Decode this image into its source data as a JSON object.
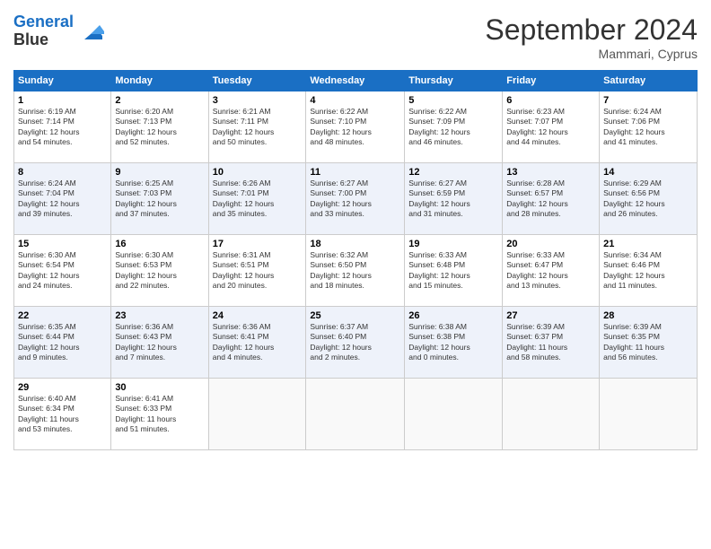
{
  "header": {
    "logo_line1": "General",
    "logo_line2": "Blue",
    "month_title": "September 2024",
    "location": "Mammari, Cyprus"
  },
  "weekdays": [
    "Sunday",
    "Monday",
    "Tuesday",
    "Wednesday",
    "Thursday",
    "Friday",
    "Saturday"
  ],
  "weeks": [
    [
      {
        "day": "1",
        "info": "Sunrise: 6:19 AM\nSunset: 7:14 PM\nDaylight: 12 hours\nand 54 minutes."
      },
      {
        "day": "2",
        "info": "Sunrise: 6:20 AM\nSunset: 7:13 PM\nDaylight: 12 hours\nand 52 minutes."
      },
      {
        "day": "3",
        "info": "Sunrise: 6:21 AM\nSunset: 7:11 PM\nDaylight: 12 hours\nand 50 minutes."
      },
      {
        "day": "4",
        "info": "Sunrise: 6:22 AM\nSunset: 7:10 PM\nDaylight: 12 hours\nand 48 minutes."
      },
      {
        "day": "5",
        "info": "Sunrise: 6:22 AM\nSunset: 7:09 PM\nDaylight: 12 hours\nand 46 minutes."
      },
      {
        "day": "6",
        "info": "Sunrise: 6:23 AM\nSunset: 7:07 PM\nDaylight: 12 hours\nand 44 minutes."
      },
      {
        "day": "7",
        "info": "Sunrise: 6:24 AM\nSunset: 7:06 PM\nDaylight: 12 hours\nand 41 minutes."
      }
    ],
    [
      {
        "day": "8",
        "info": "Sunrise: 6:24 AM\nSunset: 7:04 PM\nDaylight: 12 hours\nand 39 minutes."
      },
      {
        "day": "9",
        "info": "Sunrise: 6:25 AM\nSunset: 7:03 PM\nDaylight: 12 hours\nand 37 minutes."
      },
      {
        "day": "10",
        "info": "Sunrise: 6:26 AM\nSunset: 7:01 PM\nDaylight: 12 hours\nand 35 minutes."
      },
      {
        "day": "11",
        "info": "Sunrise: 6:27 AM\nSunset: 7:00 PM\nDaylight: 12 hours\nand 33 minutes."
      },
      {
        "day": "12",
        "info": "Sunrise: 6:27 AM\nSunset: 6:59 PM\nDaylight: 12 hours\nand 31 minutes."
      },
      {
        "day": "13",
        "info": "Sunrise: 6:28 AM\nSunset: 6:57 PM\nDaylight: 12 hours\nand 28 minutes."
      },
      {
        "day": "14",
        "info": "Sunrise: 6:29 AM\nSunset: 6:56 PM\nDaylight: 12 hours\nand 26 minutes."
      }
    ],
    [
      {
        "day": "15",
        "info": "Sunrise: 6:30 AM\nSunset: 6:54 PM\nDaylight: 12 hours\nand 24 minutes."
      },
      {
        "day": "16",
        "info": "Sunrise: 6:30 AM\nSunset: 6:53 PM\nDaylight: 12 hours\nand 22 minutes."
      },
      {
        "day": "17",
        "info": "Sunrise: 6:31 AM\nSunset: 6:51 PM\nDaylight: 12 hours\nand 20 minutes."
      },
      {
        "day": "18",
        "info": "Sunrise: 6:32 AM\nSunset: 6:50 PM\nDaylight: 12 hours\nand 18 minutes."
      },
      {
        "day": "19",
        "info": "Sunrise: 6:33 AM\nSunset: 6:48 PM\nDaylight: 12 hours\nand 15 minutes."
      },
      {
        "day": "20",
        "info": "Sunrise: 6:33 AM\nSunset: 6:47 PM\nDaylight: 12 hours\nand 13 minutes."
      },
      {
        "day": "21",
        "info": "Sunrise: 6:34 AM\nSunset: 6:46 PM\nDaylight: 12 hours\nand 11 minutes."
      }
    ],
    [
      {
        "day": "22",
        "info": "Sunrise: 6:35 AM\nSunset: 6:44 PM\nDaylight: 12 hours\nand 9 minutes."
      },
      {
        "day": "23",
        "info": "Sunrise: 6:36 AM\nSunset: 6:43 PM\nDaylight: 12 hours\nand 7 minutes."
      },
      {
        "day": "24",
        "info": "Sunrise: 6:36 AM\nSunset: 6:41 PM\nDaylight: 12 hours\nand 4 minutes."
      },
      {
        "day": "25",
        "info": "Sunrise: 6:37 AM\nSunset: 6:40 PM\nDaylight: 12 hours\nand 2 minutes."
      },
      {
        "day": "26",
        "info": "Sunrise: 6:38 AM\nSunset: 6:38 PM\nDaylight: 12 hours\nand 0 minutes."
      },
      {
        "day": "27",
        "info": "Sunrise: 6:39 AM\nSunset: 6:37 PM\nDaylight: 11 hours\nand 58 minutes."
      },
      {
        "day": "28",
        "info": "Sunrise: 6:39 AM\nSunset: 6:35 PM\nDaylight: 11 hours\nand 56 minutes."
      }
    ],
    [
      {
        "day": "29",
        "info": "Sunrise: 6:40 AM\nSunset: 6:34 PM\nDaylight: 11 hours\nand 53 minutes."
      },
      {
        "day": "30",
        "info": "Sunrise: 6:41 AM\nSunset: 6:33 PM\nDaylight: 11 hours\nand 51 minutes."
      },
      {
        "day": "",
        "info": ""
      },
      {
        "day": "",
        "info": ""
      },
      {
        "day": "",
        "info": ""
      },
      {
        "day": "",
        "info": ""
      },
      {
        "day": "",
        "info": ""
      }
    ]
  ]
}
